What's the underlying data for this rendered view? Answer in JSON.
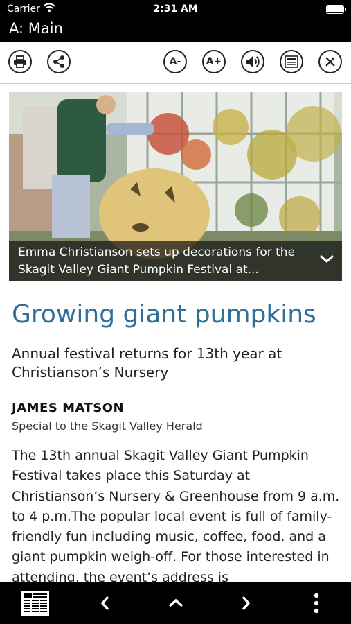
{
  "status": {
    "carrier": "Carrier",
    "time": "2:31 AM"
  },
  "title": "A: Main",
  "toolbar": {
    "font_smaller": "A-",
    "font_larger": "A+"
  },
  "photo": {
    "caption": "Emma Christianson sets up decorations for the Skagit Valley Giant Pumpkin Festival at..."
  },
  "article": {
    "headline": "Growing giant pumpkins",
    "subhead": "Annual festival returns for 13th year at Christianson’s Nursery",
    "author": "JAMES MATSON",
    "affiliation": "Special to the Skagit Valley Herald",
    "body": "The 13th annual Skagit Valley Giant Pumpkin Festival takes place this Saturday at Christianson’s Nursery & Greenhouse from 9 a.m. to 4 p.m.The popular local event is full of family- friendly fun including music, coffee, food, and a giant pumpkin weigh-off. For those interested in attending, the event’s address is"
  },
  "colors": {
    "headline": "#2f6f98",
    "bars": "#000000"
  }
}
